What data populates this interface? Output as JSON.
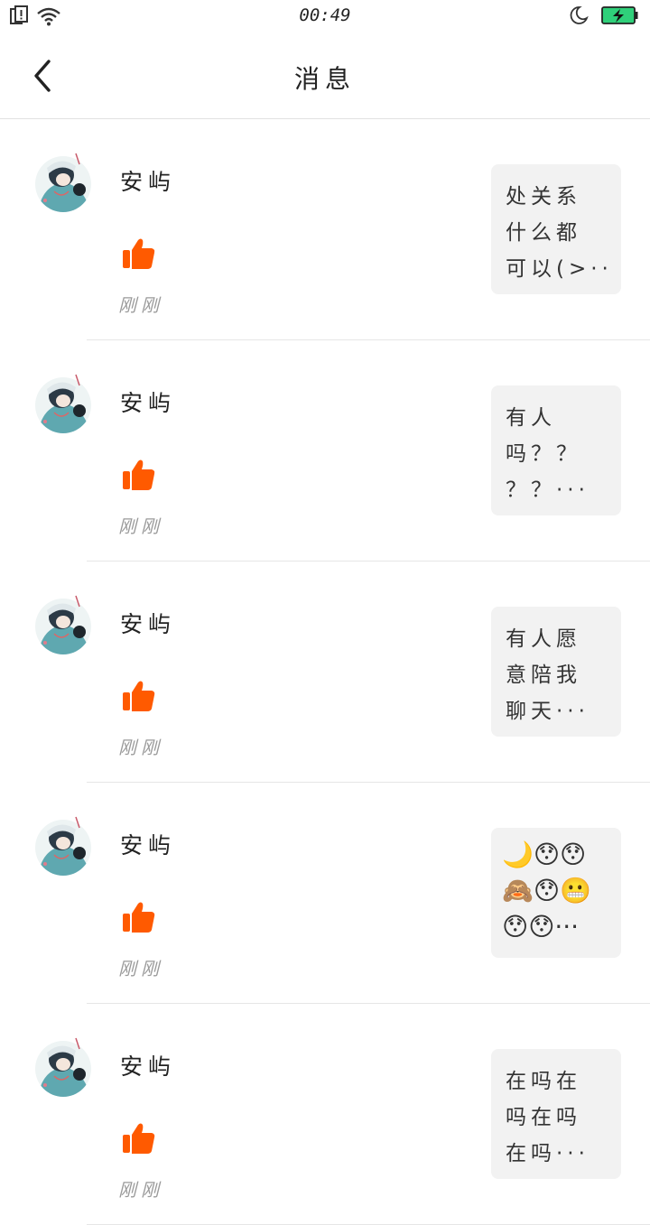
{
  "status_bar": {
    "time": "00:49",
    "left_icons": [
      "sim-alert-icon",
      "wifi-icon"
    ],
    "right_icons": [
      "moon-icon",
      "battery-charging-icon"
    ],
    "battery_color": "#2fd07a"
  },
  "header": {
    "title": "消息",
    "back_icon": "chevron-left-icon"
  },
  "colors": {
    "like": "#ff5a00",
    "preview_bg": "#f2f2f2",
    "divider": "#e6e6e6",
    "time_text": "#9a9a9a"
  },
  "messages": [
    {
      "name": "安屿",
      "action_icon": "thumbs-up-icon",
      "time": "刚刚",
      "preview": [
        "处关系",
        "什么都",
        "可以(>···"
      ]
    },
    {
      "name": "安屿",
      "action_icon": "thumbs-up-icon",
      "time": "刚刚",
      "preview": [
        "有人",
        "吗？？",
        "？？···"
      ]
    },
    {
      "name": "安屿",
      "action_icon": "thumbs-up-icon",
      "time": "刚刚",
      "preview": [
        "有人愿",
        "意陪我",
        "聊天···"
      ]
    },
    {
      "name": "安屿",
      "action_icon": "thumbs-up-icon",
      "time": "刚刚",
      "preview": [
        "🌙😯😯",
        "🙈😯😬",
        "😯😯···"
      ]
    },
    {
      "name": "安屿",
      "action_icon": "thumbs-up-icon",
      "time": "刚刚",
      "preview": [
        "在吗在",
        "吗在吗",
        "在吗···"
      ]
    }
  ]
}
